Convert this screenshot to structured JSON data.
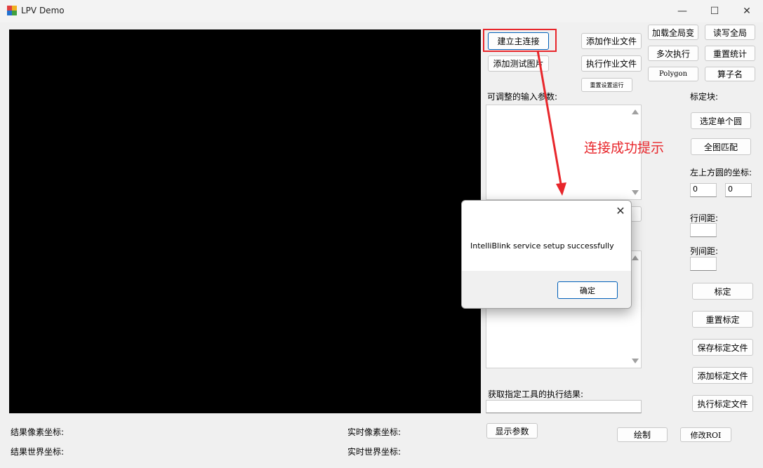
{
  "window": {
    "title": "LPV Demo",
    "controls": {
      "minimize": "—",
      "maximize": "☐",
      "close": "✕"
    }
  },
  "buttons": {
    "connect": "建立主连接",
    "add_test_image": "添加测试图片",
    "add_job_file": "添加作业文件",
    "exec_job_file": "执行作业文件",
    "reset_run": "重置设置运行",
    "load_global": "加载全局变",
    "read_write_global": "读写全局",
    "multi_exec": "多次执行",
    "reset_stats": "重置统计",
    "polygon": "Polygon",
    "operator_name": "算子名",
    "select_single_circle": "选定单个圆",
    "full_match": "全图匹配",
    "calibrate": "标定",
    "reset_calibration": "重置标定",
    "save_calib_file": "保存标定文件",
    "add_calib_file": "添加标定文件",
    "exec_calib_file": "执行标定文件",
    "show_params": "显示参数",
    "draw": "绘制",
    "modify_roi": "修改ROI"
  },
  "labels": {
    "adjustable_params": "可调整的输入参数:",
    "calib_block": "标定块:",
    "top_left_circle": "左上方圆的坐标:",
    "row_spacing": "行间距:",
    "col_spacing": "列间距:",
    "get_tool_result": "获取指定工具的执行结果:",
    "result_pixel": "结果像素坐标:",
    "result_world": "结果世界坐标:",
    "realtime_pixel": "实时像素坐标:",
    "realtime_world": "实时世界坐标:"
  },
  "inputs": {
    "circle_x": "0",
    "circle_y": "0",
    "row_spacing": "",
    "col_spacing": "",
    "tool_result": ""
  },
  "annotation": {
    "text": "连接成功提示",
    "color": "#e8262b"
  },
  "dialog": {
    "message": "IntelliBlink service setup successfully",
    "ok_label": "确定",
    "close_glyph": "✕"
  },
  "colors": {
    "accent": "#005fb8",
    "canvas": "#000000",
    "highlight": "#e8262b"
  }
}
